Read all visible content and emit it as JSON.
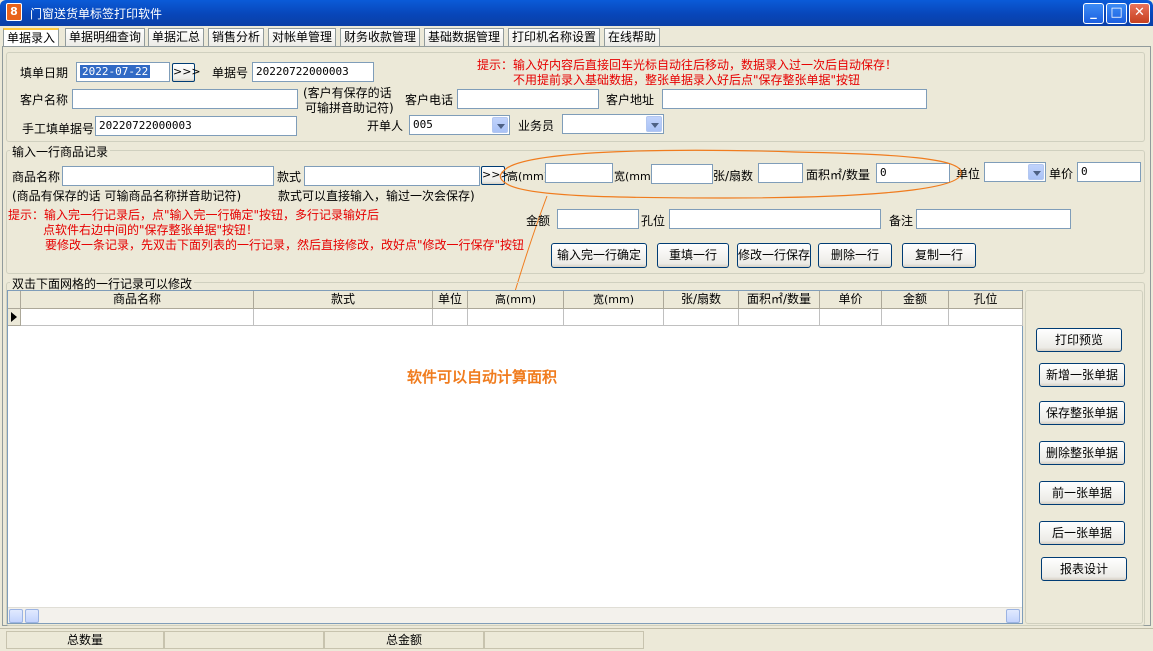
{
  "window": {
    "title": "门窗送货单标签打印软件",
    "app_icon_glyph": "8"
  },
  "tabs": [
    {
      "label": "单据录入",
      "active": true
    },
    {
      "label": "单据明细查询"
    },
    {
      "label": "单据汇总"
    },
    {
      "label": "销售分析"
    },
    {
      "label": "对帐单管理"
    },
    {
      "label": "财务收款管理"
    },
    {
      "label": "基础数据管理"
    },
    {
      "label": "打印机名称设置"
    },
    {
      "label": "在线帮助"
    }
  ],
  "header": {
    "date_label": "填单日期",
    "date_value": "2022-07-22",
    "expand_btn": ">>>",
    "doc_no_label": "单据号",
    "doc_no_value": "20220722000003",
    "tip_line1": "提示：输入好内容后直接回车光标自动往后移动，数据录入过一次后自动保存！",
    "tip_line2": "不用提前录入基础数据，整张单据录入好后点\"保存整张单据\"按钮",
    "customer_label": "客户名称",
    "customer_value": "",
    "customer_hint1": "(客户有保存的话",
    "customer_hint2": "可输拼音助记符)",
    "phone_label": "客户电话",
    "phone_value": "",
    "address_label": "客户地址",
    "address_value": "",
    "manual_no_label": "手工填单据号",
    "manual_no_value": "20220722000003",
    "issuer_label": "开单人",
    "issuer_value": "005",
    "salesman_label": "业务员",
    "salesman_value": ""
  },
  "item_entry": {
    "group_title": "输入一行商品记录",
    "product_label": "商品名称",
    "product_value": "",
    "product_hint": "(商品有保存的话 可输商品名称拼音助记符)",
    "style_label": "款式",
    "style_value": "",
    "style_hint": "款式可以直接输入，输过一次会保存)",
    "height_label": "高(mm)",
    "height_value": "",
    "width_label": "宽(mm)",
    "width_value": "",
    "sheets_label": "张/扇数",
    "sheets_value": "",
    "area_label": "面积㎡/数量",
    "area_value": "0",
    "unit_label": "单位",
    "unit_value": "",
    "price_label": "单价",
    "price_value": "0",
    "amount_label": "金额",
    "amount_value": "",
    "hole_label": "孔位",
    "hole_value": "",
    "note_label": "备注",
    "note_value": "",
    "tip_line1": "提示：输入完一行记录后，点\"输入完一行确定\"按钮，多行记录输好后",
    "tip_line2": "点软件右边中间的\"保存整张单据\"按钮！",
    "tip_line3": "要修改一条记录，先双击下面列表的一行记录，然后直接修改，改好点\"修改一行保存\"按钮",
    "btn_confirm": "输入完一行确定",
    "btn_refill": "重填一行",
    "btn_modify": "修改一行保存",
    "btn_delete": "删除一行",
    "btn_copy": "复制一行"
  },
  "grid": {
    "group_title": "双击下面网格的一行记录可以修改",
    "columns": [
      "商品名称",
      "款式",
      "单位",
      "高(mm)",
      "宽(mm)",
      "张/扇数",
      "面积㎡/数量",
      "单价",
      "金额",
      "孔位"
    ]
  },
  "annotation": {
    "text": "软件可以自动计算面积",
    "color": "#F07C1E"
  },
  "side_buttons": {
    "print_preview": "打印预览",
    "new_doc": "新增一张单据",
    "save_doc": "保存整张单据",
    "delete_doc": "删除整张单据",
    "prev_doc": "前一张单据",
    "next_doc": "后一张单据",
    "report_design": "报表设计"
  },
  "status": {
    "total_qty_label": "总数量",
    "total_qty_value": "",
    "total_amount_label": "总金额",
    "total_amount_value": ""
  },
  "colors": {
    "tip_red": "#E60000",
    "titlebar_blue": "#0846B9",
    "window_bg": "#ECE9D8"
  }
}
